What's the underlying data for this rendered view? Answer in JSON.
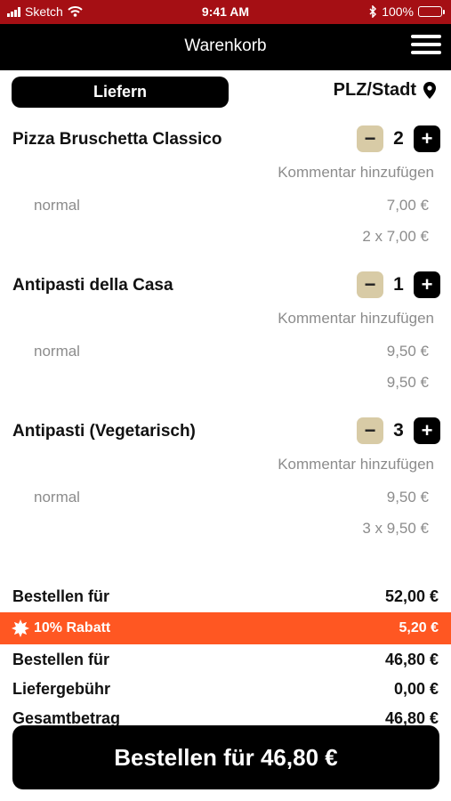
{
  "status_bar": {
    "carrier": "Sketch",
    "time": "9:41 AM",
    "battery": "100%"
  },
  "nav": {
    "title": "Warenkorb"
  },
  "delivery": {
    "mode_label": "Liefern",
    "location_label": "PLZ/Stadt"
  },
  "items": [
    {
      "name": "Pizza Bruschetta Classico",
      "quantity": "2",
      "comment": "Kommentar hinzufügen",
      "size": "normal",
      "unit_price": "7,00 €",
      "line_total": "2 x 7,00 €"
    },
    {
      "name": "Antipasti della Casa",
      "quantity": "1",
      "comment": "Kommentar hinzufügen",
      "size": "normal",
      "unit_price": "9,50 €",
      "line_total": "9,50 €"
    },
    {
      "name": "Antipasti (Vegetarisch)",
      "quantity": "3",
      "comment": "Kommentar hinzufügen",
      "size": "normal",
      "unit_price": "9,50 €",
      "line_total": "3 x 9,50 €"
    }
  ],
  "summary": {
    "subtotal_label": "Bestellen für",
    "subtotal_value": "52,00 €",
    "discount_label": "10% Rabatt",
    "discount_value": "5,20 €",
    "after_discount_label": "Bestellen für",
    "after_discount_value": "46,80 €",
    "delivery_fee_label": "Liefergebühr",
    "delivery_fee_value": "0,00 €",
    "total_label": "Gesamtbetrag",
    "total_value": "46,80 €"
  },
  "order_button": {
    "label": "Bestellen für 46,80 €"
  },
  "colors": {
    "status_bar": "#a50f14",
    "nav": "#000000",
    "discount": "#ff5722",
    "minus_button": "#d8cba6"
  }
}
